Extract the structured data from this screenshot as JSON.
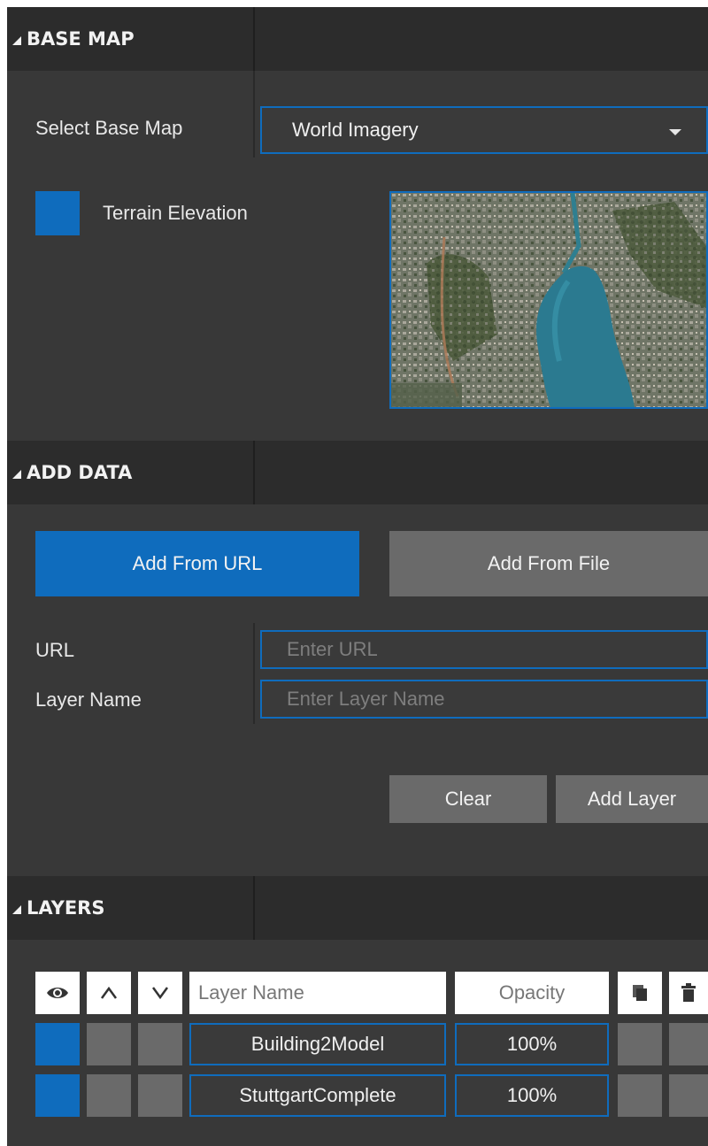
{
  "base_map": {
    "header": "BASE MAP",
    "select_label": "Select Base Map",
    "selected": "World Imagery",
    "terrain_label": "Terrain Elevation",
    "terrain_checked": true
  },
  "add_data": {
    "header": "ADD DATA",
    "tab_url": "Add From URL",
    "tab_file": "Add From File",
    "url_label": "URL",
    "url_placeholder": "Enter URL",
    "layer_name_label": "Layer Name",
    "layer_name_placeholder": "Enter Layer Name",
    "clear": "Clear",
    "add_layer": "Add Layer"
  },
  "layers": {
    "header": "LAYERS",
    "columns": {
      "name": "Layer Name",
      "opacity": "Opacity"
    },
    "rows": [
      {
        "name": "Building2Model",
        "opacity": "100%",
        "visible": true
      },
      {
        "name": "StuttgartComplete",
        "opacity": "100%",
        "visible": true
      }
    ]
  },
  "colors": {
    "accent": "#0f6cbd",
    "panel": "#383838",
    "header": "#2c2c2c",
    "button_gray": "#6a6a6a"
  }
}
